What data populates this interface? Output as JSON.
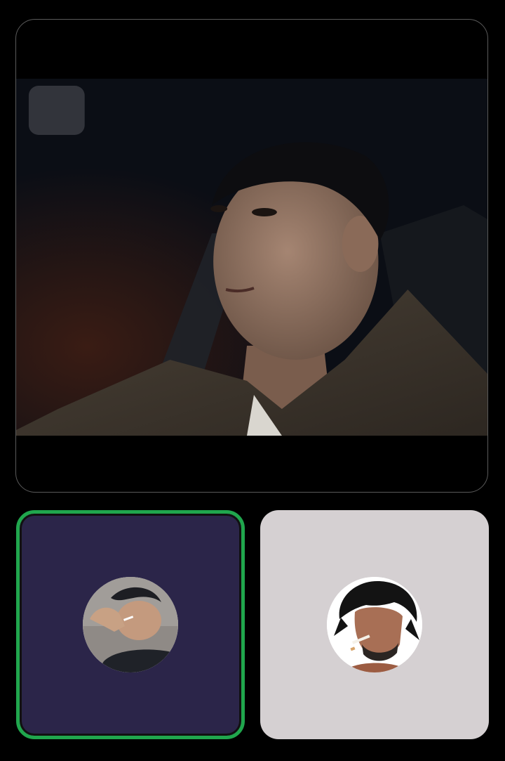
{
  "call": {
    "main_video": {
      "participant": "video-stream",
      "border_color": "#5a5a5a"
    },
    "participants": [
      {
        "id": "participant-self",
        "tile_color": "#2b2549",
        "speaking": true,
        "speaking_ring_color": "#20a64d",
        "avatar_icon": "user-photo-avatar"
      },
      {
        "id": "participant-other",
        "tile_color": "#d5d0d2",
        "speaking": false,
        "avatar_icon": "anime-avatar"
      }
    ]
  }
}
